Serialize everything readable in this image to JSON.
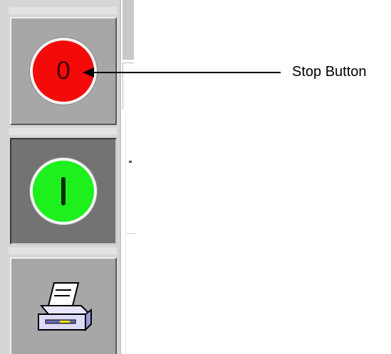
{
  "toolbar": {
    "stop_button": {
      "glyph": "0",
      "color": "#f50a0a"
    },
    "start_button": {
      "glyph": "I",
      "color": "#1df01d"
    },
    "print_button": {
      "icon": "printer-icon"
    }
  },
  "callout": {
    "label": "Stop Button"
  }
}
